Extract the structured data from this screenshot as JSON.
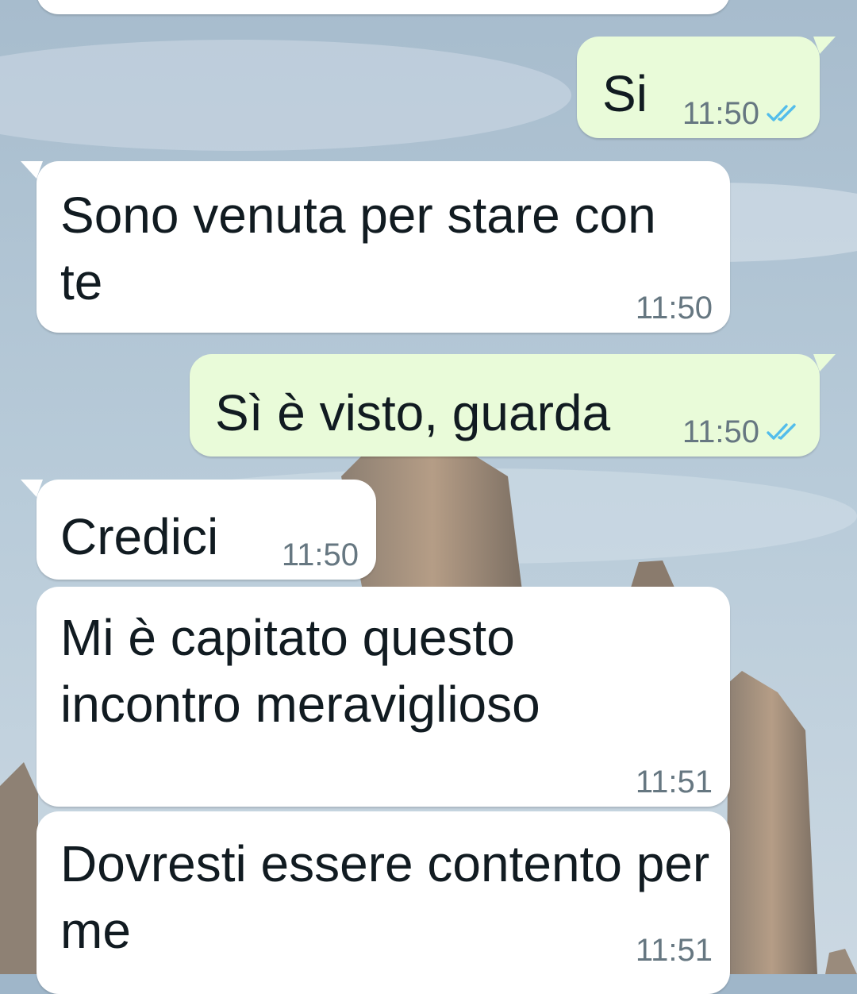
{
  "messages": [
    {
      "direction": "outgoing",
      "text": "Si",
      "time": "11:50",
      "status_icon": "double-check-blue-icon"
    },
    {
      "direction": "incoming",
      "text": "Sono venuta per stare con te",
      "time": "11:50"
    },
    {
      "direction": "outgoing",
      "text": "Sì è visto, guarda",
      "time": "11:50",
      "status_icon": "double-check-blue-icon"
    },
    {
      "direction": "incoming",
      "text": "Credici",
      "time": "11:50"
    },
    {
      "direction": "incoming",
      "text": "Mi è capitato questo incontro meraviglioso",
      "time": "11:51"
    },
    {
      "direction": "incoming",
      "text": "Dovresti essere contento per me",
      "time": "11:51"
    }
  ],
  "colors": {
    "incoming_bubble": "#ffffff",
    "outgoing_bubble": "#e9fbd9",
    "timestamp": "#667781",
    "read_ticks": "#53bdeb"
  }
}
